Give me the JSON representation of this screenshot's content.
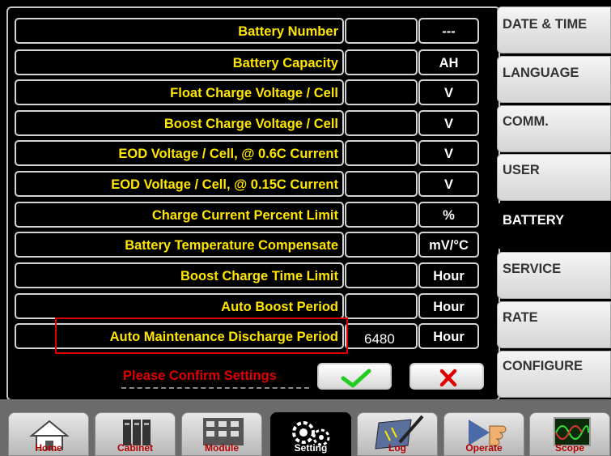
{
  "rows": [
    {
      "label": "Battery Number",
      "value": "",
      "unit": "---"
    },
    {
      "label": "Battery Capacity",
      "value": "",
      "unit": "AH"
    },
    {
      "label": "Float Charge Voltage / Cell",
      "value": "",
      "unit": "V"
    },
    {
      "label": "Boost Charge Voltage / Cell",
      "value": "",
      "unit": "V"
    },
    {
      "label": "EOD Voltage / Cell, @ 0.6C Current",
      "value": "",
      "unit": "V"
    },
    {
      "label": "EOD Voltage / Cell, @ 0.15C Current",
      "value": "",
      "unit": "V"
    },
    {
      "label": "Charge Current Percent Limit",
      "value": "",
      "unit": "%"
    },
    {
      "label": "Battery Temperature Compensate",
      "value": "",
      "unit": "mV/°C"
    },
    {
      "label": "Boost Charge Time Limit",
      "value": "",
      "unit": "Hour"
    },
    {
      "label": "Auto Boost Period",
      "value": "",
      "unit": "Hour"
    },
    {
      "label": "Auto Maintenance Discharge Period",
      "value": "6480",
      "unit": "Hour"
    }
  ],
  "confirm": {
    "text": "Please Confirm Settings",
    "ok_icon": "check-icon",
    "cancel_icon": "x-icon"
  },
  "tabs": [
    {
      "label": "DATE & TIME",
      "active": false
    },
    {
      "label": "LANGUAGE",
      "active": false
    },
    {
      "label": "COMM.",
      "active": false
    },
    {
      "label": "USER",
      "active": false
    },
    {
      "label": "BATTERY",
      "active": true
    },
    {
      "label": "SERVICE",
      "active": false
    },
    {
      "label": "RATE",
      "active": false
    },
    {
      "label": "CONFIGURE",
      "active": false
    }
  ],
  "nav": [
    {
      "label": "Home",
      "icon": "home-icon",
      "active": false
    },
    {
      "label": "Cabinet",
      "icon": "cabinet-icon",
      "active": false
    },
    {
      "label": "Module",
      "icon": "module-icon",
      "active": false
    },
    {
      "label": "Setting",
      "icon": "gear-icon",
      "active": true
    },
    {
      "label": "Log",
      "icon": "log-icon",
      "active": false
    },
    {
      "label": "Operate",
      "icon": "operate-icon",
      "active": false
    },
    {
      "label": "Scope",
      "icon": "scope-icon",
      "active": false
    }
  ],
  "colors": {
    "label_text": "#ffe600",
    "highlight": "#e00000",
    "ok": "#22cc22",
    "cancel": "#e00000",
    "nav_label": "#b50000"
  }
}
